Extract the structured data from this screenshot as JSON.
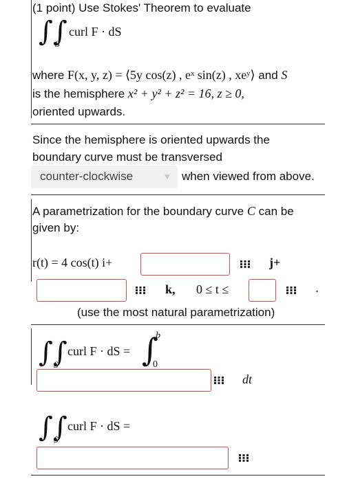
{
  "question": {
    "header": "(1 point) Use Stokes' Theorem to evaluate",
    "integral_expr": "curl F · dS",
    "integral_subscript": "S",
    "where_prefix": "where",
    "field_def": "F(x, y, z) = ⟨5y cos(z) , eˣ sin(z) , xeʸ⟩",
    "and_word": "and",
    "s_var": "S",
    "hemisphere_prefix": "is the hemisphere",
    "hemisphere_eq": "x² + y² + z² = 16,  z ≥ 0,",
    "orientation": "oriented upwards."
  },
  "part1": {
    "text_line1": "Since the hemisphere is oriented upwards the",
    "text_line2": "boundary curve must be transversed",
    "dropdown_value": "counter-clockwise",
    "after_dropdown": "when viewed from above."
  },
  "part2": {
    "text_line1_pre": "A parametrization for the boundary curve",
    "curve_var": "C",
    "text_line1_post": "can be",
    "text_line2": "given by:",
    "r_expr": "r(t) = 4 cos(t) i+",
    "j_label": "j+",
    "k_label": "k,",
    "t_range": "0 ≤ t ≤",
    "period": ".",
    "hint": "(use the most natural parametrization)"
  },
  "part3": {
    "lhs": "curl F · dS =",
    "subscript": "S",
    "upper_limit": "b",
    "lower_limit": "0",
    "dt_label": "dt"
  },
  "part4": {
    "lhs": "curl F · dS =",
    "subscript": "S"
  }
}
